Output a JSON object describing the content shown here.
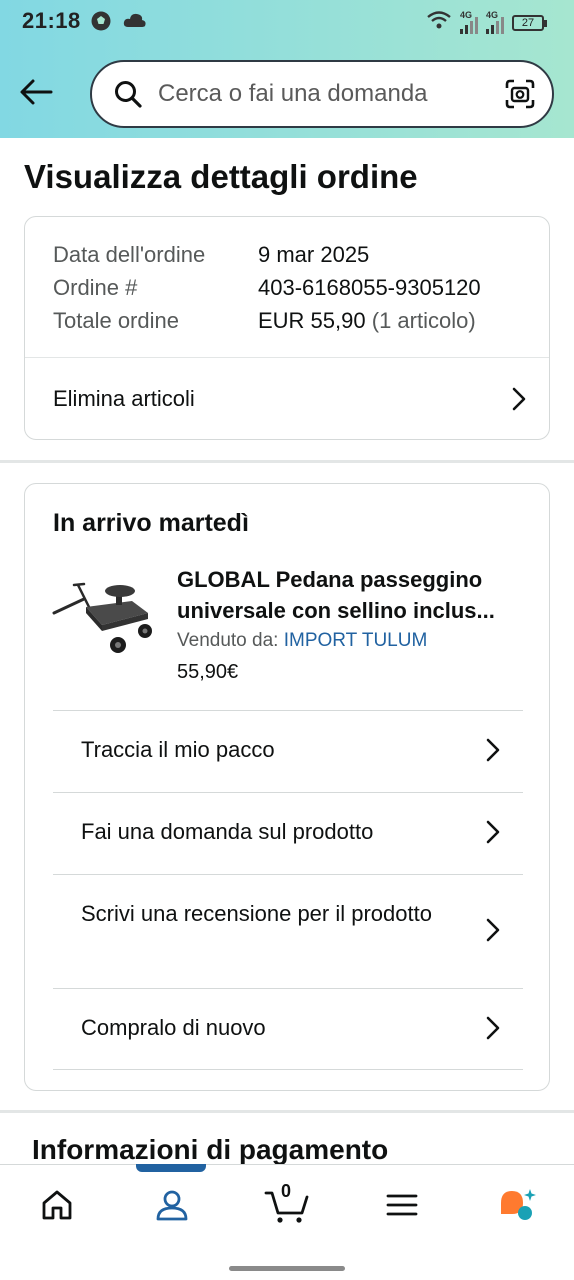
{
  "status_bar": {
    "time": "21:18",
    "battery": "27",
    "network_1": "4G",
    "network_2": "4G"
  },
  "header": {
    "search_placeholder": "Cerca o fai una domanda",
    "back_icon": "arrow-left-icon",
    "search_icon": "search-icon",
    "camera_icon": "camera-scan-icon"
  },
  "page": {
    "title": "Visualizza dettagli ordine"
  },
  "order_summary": {
    "date_label": "Data dell'ordine",
    "date_value": "9 mar 2025",
    "number_label": "Ordine #",
    "number_value": "403-6168055-9305120",
    "total_label": "Totale ordine",
    "total_value": "EUR 55,90",
    "total_note": "(1 articolo)",
    "remove_items_label": "Elimina articoli"
  },
  "shipment": {
    "status": "In arrivo martedì",
    "product_title_line1": "GLOBAL Pedana passeggino",
    "product_title_line2": "universale con sellino inclus...",
    "seller_prefix": "Venduto da:",
    "seller_name": "IMPORT TULUM",
    "price": "55,90€",
    "actions": [
      {
        "label": "Traccia il mio pacco"
      },
      {
        "label": "Fai una domanda sul prodotto"
      },
      {
        "label": "Scrivi una recensione per il prodotto"
      },
      {
        "label": "Compralo di nuovo"
      }
    ]
  },
  "payment": {
    "title": "Informazioni di pagamento"
  },
  "bottom_nav": {
    "cart_count": "0",
    "items": [
      "home-icon",
      "account-icon",
      "cart-icon",
      "menu-icon",
      "rufus-ai-icon"
    ],
    "active": "account-icon"
  },
  "colors": {
    "link_blue": "#2162a1",
    "header_gradient_start": "#82d8e3",
    "header_gradient_end": "#a6e6d0",
    "accent_orange": "#ff7a2f",
    "accent_teal": "#1aa1b5"
  }
}
